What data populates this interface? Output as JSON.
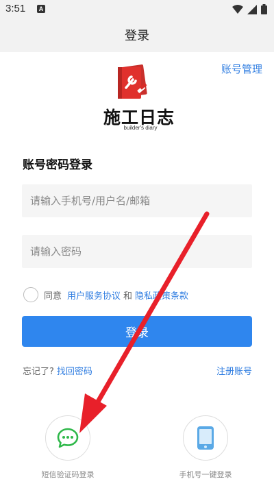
{
  "status_bar": {
    "time": "3:51",
    "notification_icon": "A",
    "icons": [
      "wifi-icon",
      "cellular-icon",
      "battery-icon"
    ]
  },
  "header": {
    "title": "登录"
  },
  "account_manage_label": "账号管理",
  "logo": {
    "title": "施工日志",
    "subtitle": "builder's diary"
  },
  "form": {
    "section_title": "账号密码登录",
    "phone_placeholder": "请输入手机号/用户名/邮箱",
    "password_placeholder": "请输入密码",
    "agree_prefix": "同意",
    "user_agreement": "用户服务协议",
    "and_text": "和",
    "privacy_policy": "隐私政策条款",
    "login_button": "登录"
  },
  "links": {
    "forgot_prefix": "忘记了?",
    "retrieve_password": "找回密码",
    "register": "注册账号"
  },
  "alt_login": {
    "sms_label": "短信验证码登录",
    "phone_label": "手机号一键登录"
  },
  "colors": {
    "accent": "#2f86ee",
    "link": "#2f7de1",
    "sms_icon": "#2fb84a",
    "phone_icon": "#5aa9e6",
    "annotation_arrow": "#e8202a"
  }
}
